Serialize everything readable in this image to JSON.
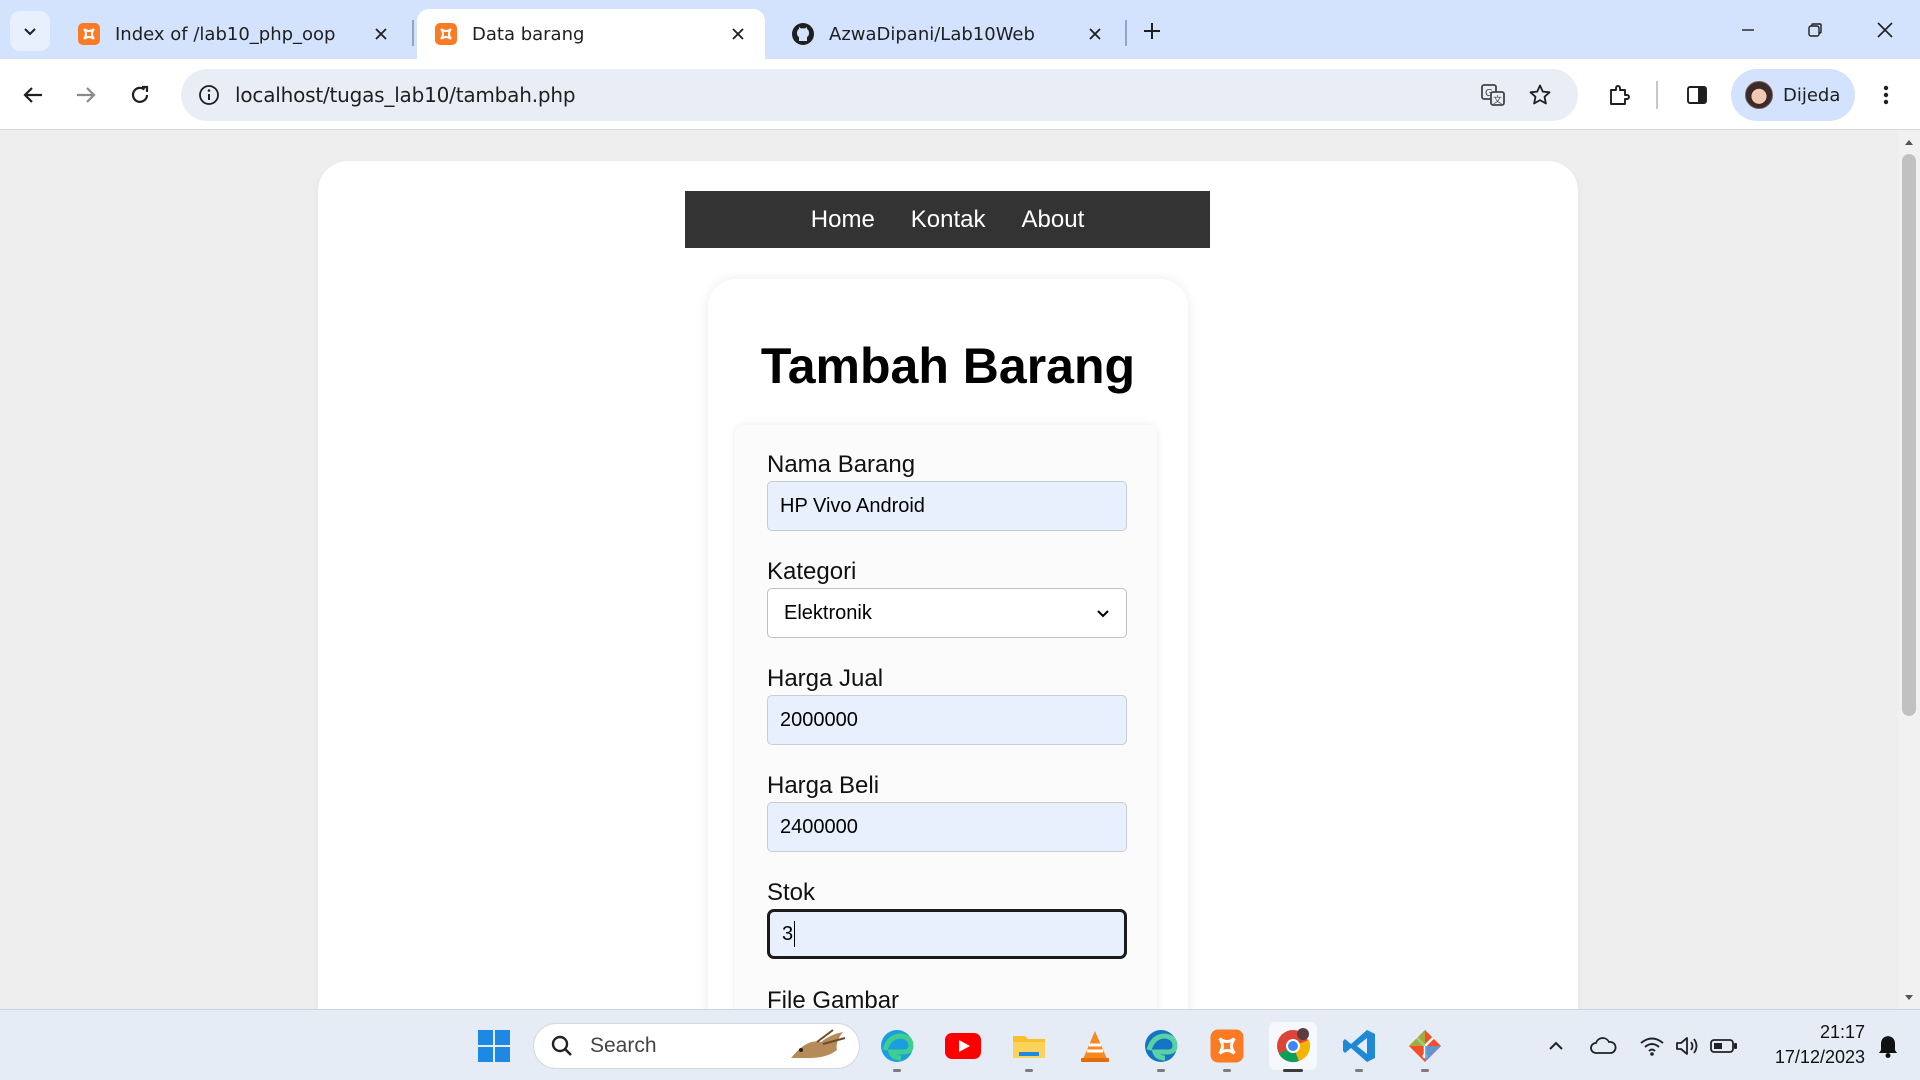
{
  "browser": {
    "tabs": [
      {
        "title": "Index of /lab10_php_oop",
        "icon": "xampp-icon",
        "active": false
      },
      {
        "title": "Data barang",
        "icon": "xampp-icon",
        "active": true
      },
      {
        "title": "AzwaDipani/Lab10Web",
        "icon": "github-icon",
        "active": false
      }
    ],
    "url": "localhost/tugas_lab10/tambah.php",
    "profile_name": "Dijeda"
  },
  "page": {
    "nav": [
      {
        "label": "Home"
      },
      {
        "label": "Kontak"
      },
      {
        "label": "About"
      }
    ],
    "heading": "Tambah Barang",
    "form": {
      "nama_label": "Nama Barang",
      "nama_value": "HP Vivo Android",
      "kategori_label": "Kategori",
      "kategori_value": "Elektronik",
      "harga_jual_label": "Harga Jual",
      "harga_jual_value": "2000000",
      "harga_beli_label": "Harga Beli",
      "harga_beli_value": "2400000",
      "stok_label": "Stok",
      "stok_value": "3",
      "gambar_label": "File Gambar"
    }
  },
  "taskbar": {
    "search_label": "Search",
    "time": "21:17",
    "date": "17/12/2023",
    "apps": [
      "windows-start-icon",
      "edge-icon",
      "youtube-icon",
      "file-explorer-icon",
      "vlc-icon",
      "edge-beta-icon",
      "xampp-icon",
      "chrome-icon",
      "vscode-icon",
      "git-icon"
    ]
  },
  "colors": {
    "tab_strip": "#d3e3fd",
    "nav_bar": "#333333",
    "input_fill": "#e8f0fe",
    "xampp_orange": "#fb7a24"
  }
}
